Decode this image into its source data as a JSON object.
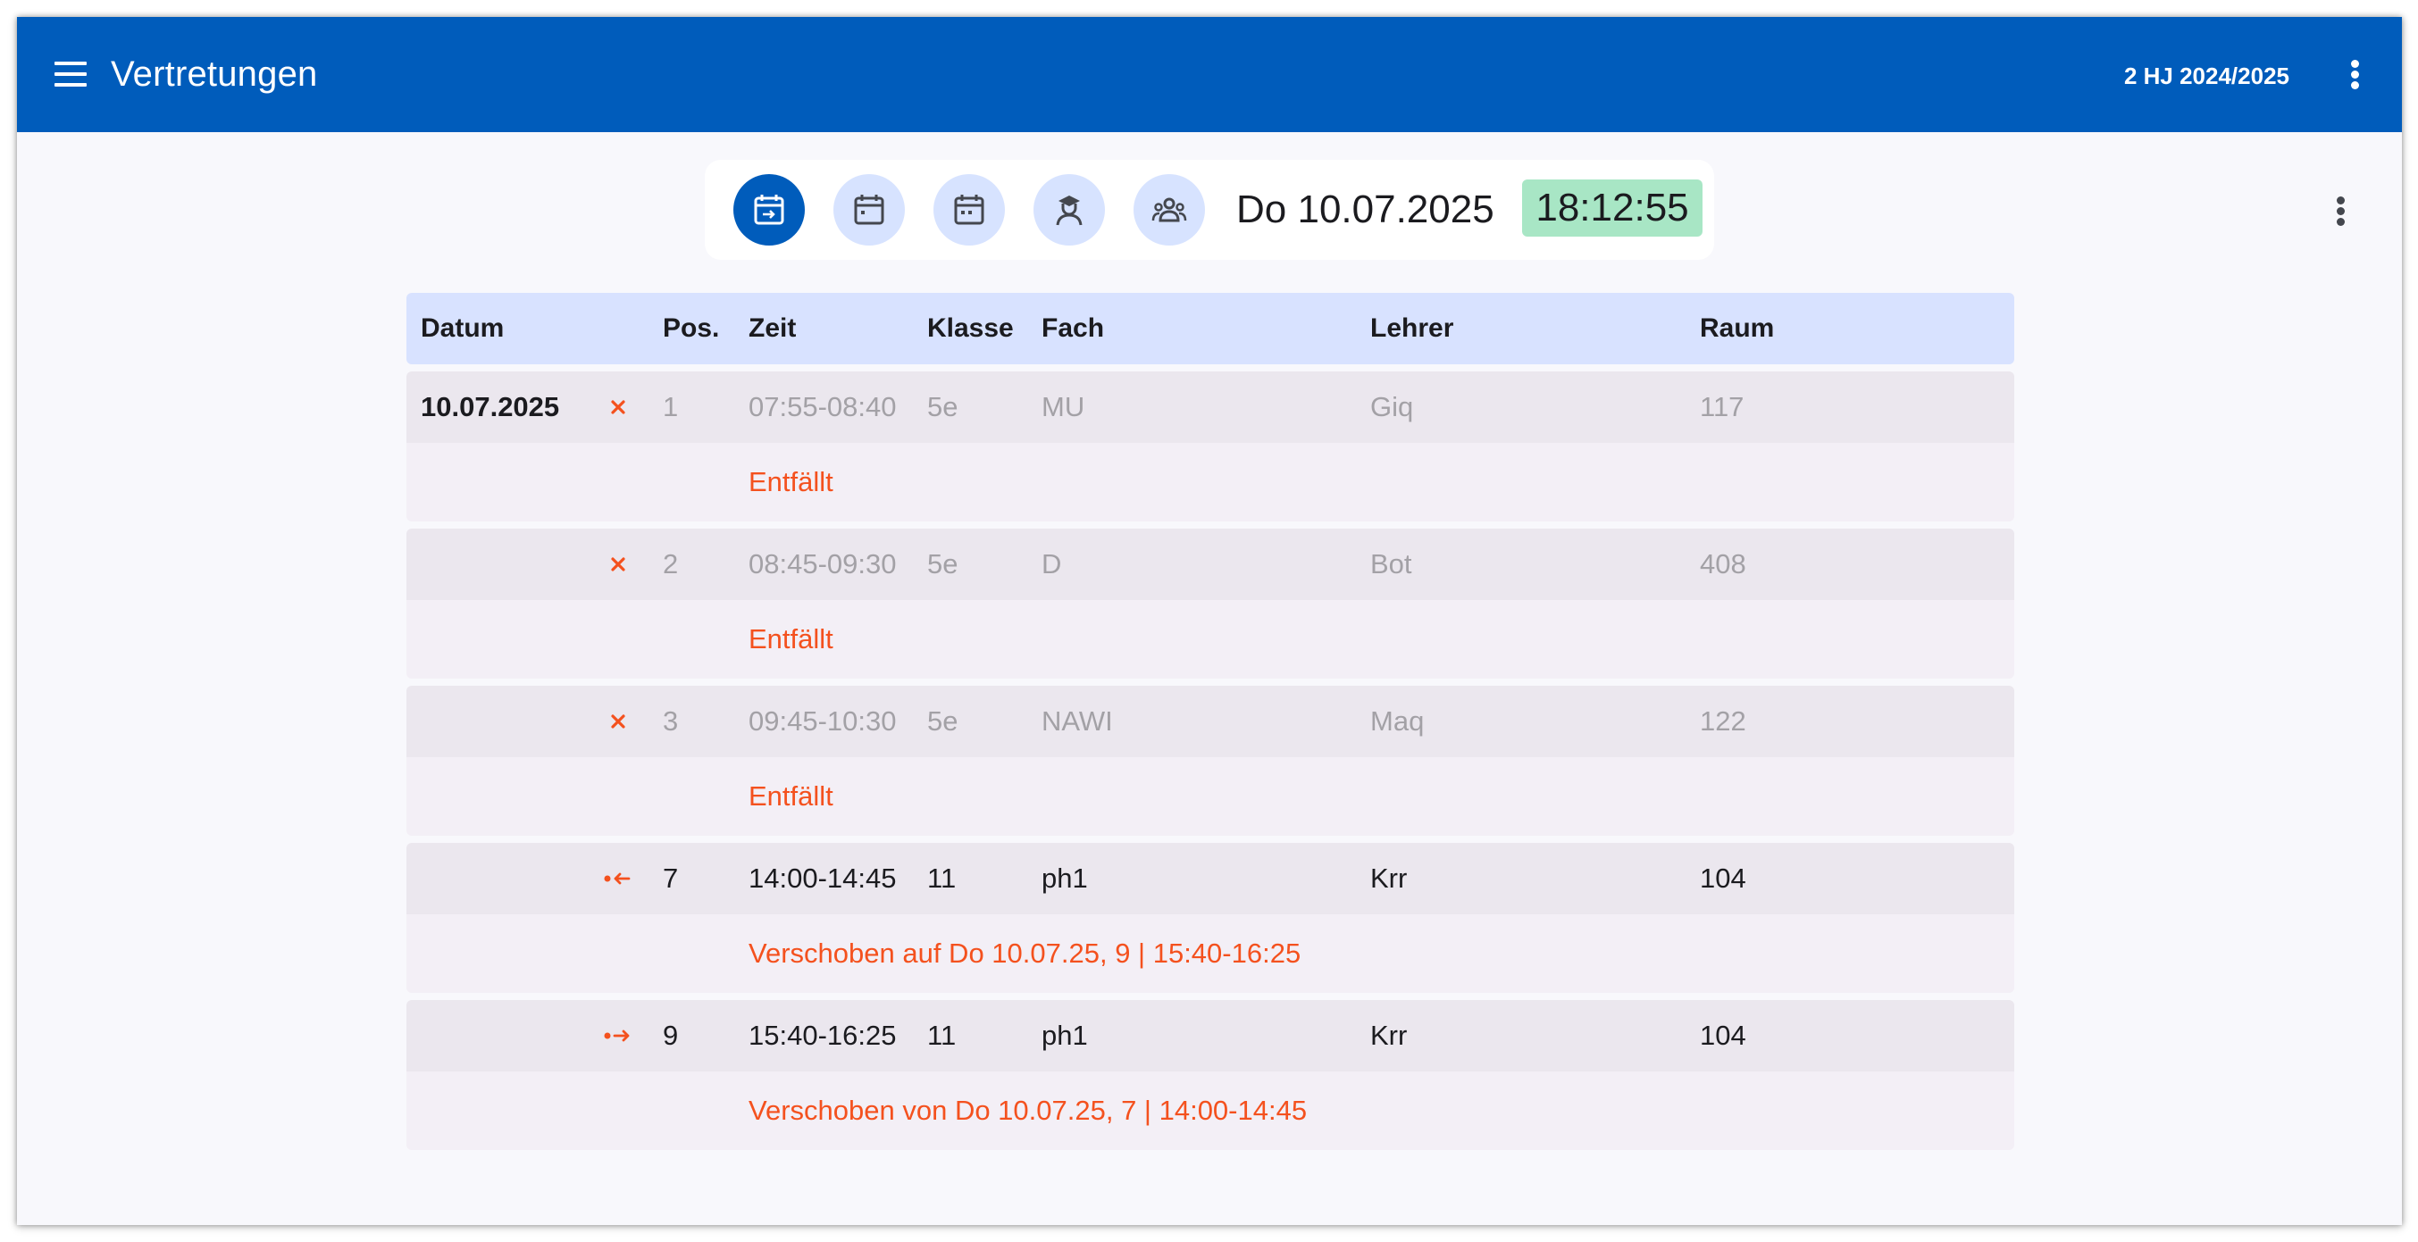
{
  "appbar": {
    "title": "Vertretungen",
    "term": "2 HJ 2024/2025",
    "icons": {
      "menu": "menu-icon",
      "more": "more-vert-icon"
    }
  },
  "toolbar": {
    "buttons": [
      {
        "icon": "calendar-today-icon",
        "active": true
      },
      {
        "icon": "calendar-icon",
        "active": false
      },
      {
        "icon": "calendar-range-icon",
        "active": false
      },
      {
        "icon": "teacher-icon",
        "active": false
      },
      {
        "icon": "group-icon",
        "active": false
      }
    ],
    "date": "Do 10.07.2025",
    "time": "18:12:55"
  },
  "table": {
    "headers": {
      "datum": "Datum",
      "pos": "Pos.",
      "zeit": "Zeit",
      "klasse": "Klasse",
      "fach": "Fach",
      "lehrer": "Lehrer",
      "raum": "Raum"
    },
    "rows": [
      {
        "datum": "10.07.2025",
        "status_icon": "cancelled-icon",
        "pos": "1",
        "zeit": "07:55-08:40",
        "klasse": "5e",
        "fach": "MU",
        "lehrer": "Giq",
        "raum": "117",
        "note": "Entfällt"
      },
      {
        "datum": "",
        "status_icon": "cancelled-icon",
        "pos": "2",
        "zeit": "08:45-09:30",
        "klasse": "5e",
        "fach": "D",
        "lehrer": "Bot",
        "raum": "408",
        "note": "Entfällt"
      },
      {
        "datum": "",
        "status_icon": "cancelled-icon",
        "pos": "3",
        "zeit": "09:45-10:30",
        "klasse": "5e",
        "fach": "NAWI",
        "lehrer": "Maq",
        "raum": "122",
        "note": "Entfällt"
      },
      {
        "datum": "",
        "status_icon": "moved-away-icon",
        "pos": "7",
        "zeit": "14:00-14:45",
        "klasse": "11",
        "fach": "ph1",
        "lehrer": "Krr",
        "raum": "104",
        "note": "Verschoben auf Do 10.07.25, 9 | 15:40-16:25"
      },
      {
        "datum": "",
        "status_icon": "moved-here-icon",
        "pos": "9",
        "zeit": "15:40-16:25",
        "klasse": "11",
        "fach": "ph1",
        "lehrer": "Krr",
        "raum": "104",
        "note": "Verschoben von Do 10.07.25, 7 | 14:00-14:45"
      }
    ]
  },
  "colors": {
    "primary": "#005cbb",
    "header_bg": "#d8e2ff",
    "button_bg": "#d7e3ff",
    "clock_bg": "#a8e6c5",
    "accent": "#f4511e",
    "row_bg": "#ebe7ee",
    "note_bg": "#f3eff6"
  }
}
